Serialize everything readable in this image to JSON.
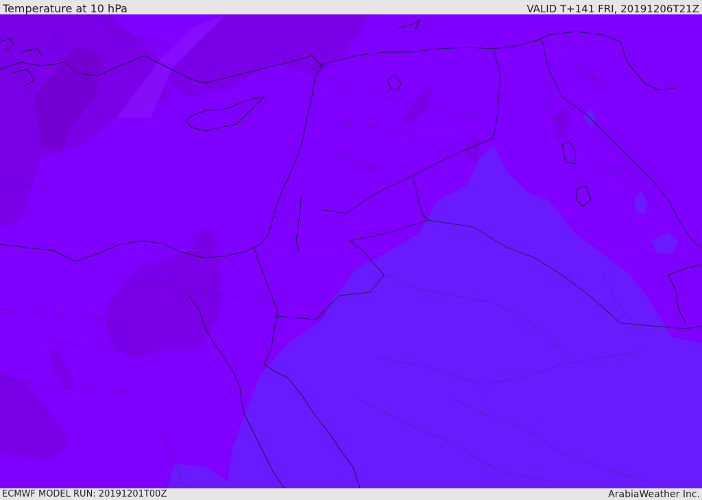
{
  "header": {
    "title": "Temperature at 10 hPa",
    "valid_time": "VALID T+141 FRI, 20191206T21Z"
  },
  "footer": {
    "model_run": "ECMWF MODEL RUN: 20191201T00Z",
    "credit": "ArabiaWeather Inc."
  },
  "map": {
    "field": "Temperature",
    "level": "10 hPa",
    "colors": {
      "warm_base": "#7f00ff",
      "warmer": "#7a00e8",
      "warmest": "#7200cc",
      "cooler": "#6a1aff",
      "coast": "#1a1a33",
      "border": "#2a2a55"
    }
  }
}
